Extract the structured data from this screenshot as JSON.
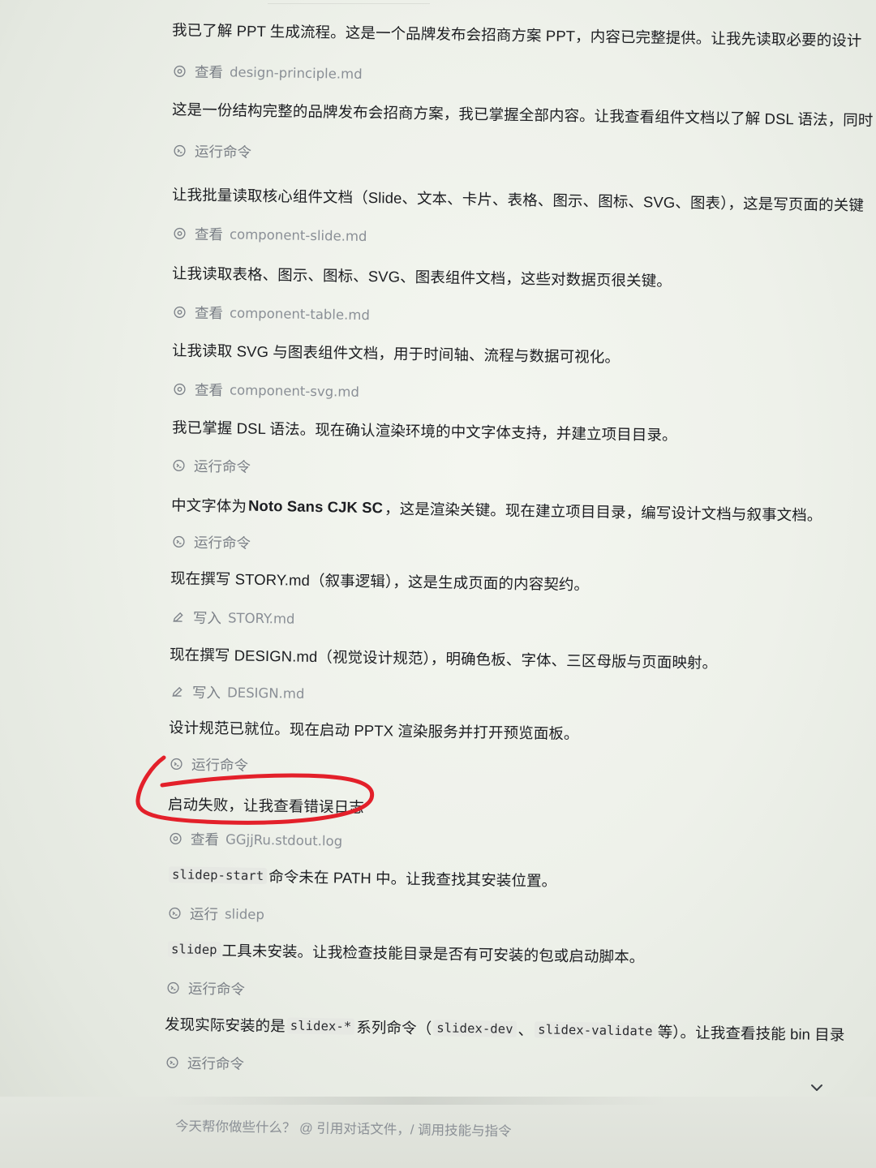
{
  "feed": {
    "m1": "我已了解 PPT 生成流程。这是一个品牌发布会招商方案 PPT，内容已完整提供。让我先读取必要的设计",
    "s1": {
      "verb": "查看",
      "file": "design-principle.md",
      "icon": "eye-icon"
    },
    "m2": "这是一份结构完整的品牌发布会招商方案，我已掌握全部内容。让我查看组件文档以了解 DSL 语法，同时",
    "s2": {
      "verb": "运行命令",
      "icon": "terminal-icon"
    },
    "m3": "让我批量读取核心组件文档（Slide、文本、卡片、表格、图示、图标、SVG、图表），这是写页面的关键",
    "s3": {
      "verb": "查看",
      "file": "component-slide.md",
      "icon": "eye-icon"
    },
    "m4": "让我读取表格、图示、图标、SVG、图表组件文档，这些对数据页很关键。",
    "s4": {
      "verb": "查看",
      "file": "component-table.md",
      "icon": "eye-icon"
    },
    "m5": "让我读取 SVG 与图表组件文档，用于时间轴、流程与数据可视化。",
    "s5": {
      "verb": "查看",
      "file": "component-svg.md",
      "icon": "eye-icon"
    },
    "m6": "我已掌握 DSL 语法。现在确认渲染环境的中文字体支持，并建立项目目录。",
    "s6": {
      "verb": "运行命令",
      "icon": "terminal-icon"
    },
    "m7": {
      "a": "中文字体为",
      "b": "Noto Sans CJK SC",
      "c": "，这是渲染关键。现在建立项目目录，编写设计文档与叙事文档。"
    },
    "s7": {
      "verb": "运行命令",
      "icon": "terminal-icon"
    },
    "m8": "现在撰写 STORY.md（叙事逻辑），这是生成页面的内容契约。",
    "s8": {
      "verb": "写入",
      "file": "STORY.md",
      "icon": "pencil-icon"
    },
    "m9": "现在撰写 DESIGN.md（视觉设计规范），明确色板、字体、三区母版与页面映射。",
    "s9": {
      "verb": "写入",
      "file": "DESIGN.md",
      "icon": "pencil-icon"
    },
    "m10": "设计规范已就位。现在启动 PPTX 渲染服务并打开预览面板。",
    "s10": {
      "verb": "运行命令",
      "icon": "terminal-icon"
    },
    "m11": "启动失败，让我查看错误日志",
    "s11": {
      "verb": "查看",
      "file": "GGjjRu.stdout.log",
      "icon": "eye-icon"
    },
    "m12": {
      "code": "slidep-start",
      "text": "命令未在 PATH 中。让我查找其安装位置。"
    },
    "s12": {
      "verb": "运行",
      "file": "slidep",
      "icon": "terminal-icon"
    },
    "m13": {
      "code": "slidep",
      "text": "工具未安装。让我检查技能目录是否有可安装的包或启动脚本。"
    },
    "s13": {
      "verb": "运行命令",
      "icon": "terminal-icon"
    },
    "m14": {
      "a": "发现实际安装的是",
      "code1": "slidex-*",
      "b": "系列命令（",
      "code2": "slidex-dev",
      "c": "、",
      "code3": "slidex-validate",
      "d": "等）。让我查看技能 bin 目录"
    },
    "s14": {
      "verb": "运行命令",
      "icon": "terminal-icon"
    }
  },
  "composer": {
    "placeholder": "今天帮你做些什么？ @ 引用对话文件，/ 调用技能与指令"
  },
  "annotation": {
    "color": "#e3202a"
  }
}
